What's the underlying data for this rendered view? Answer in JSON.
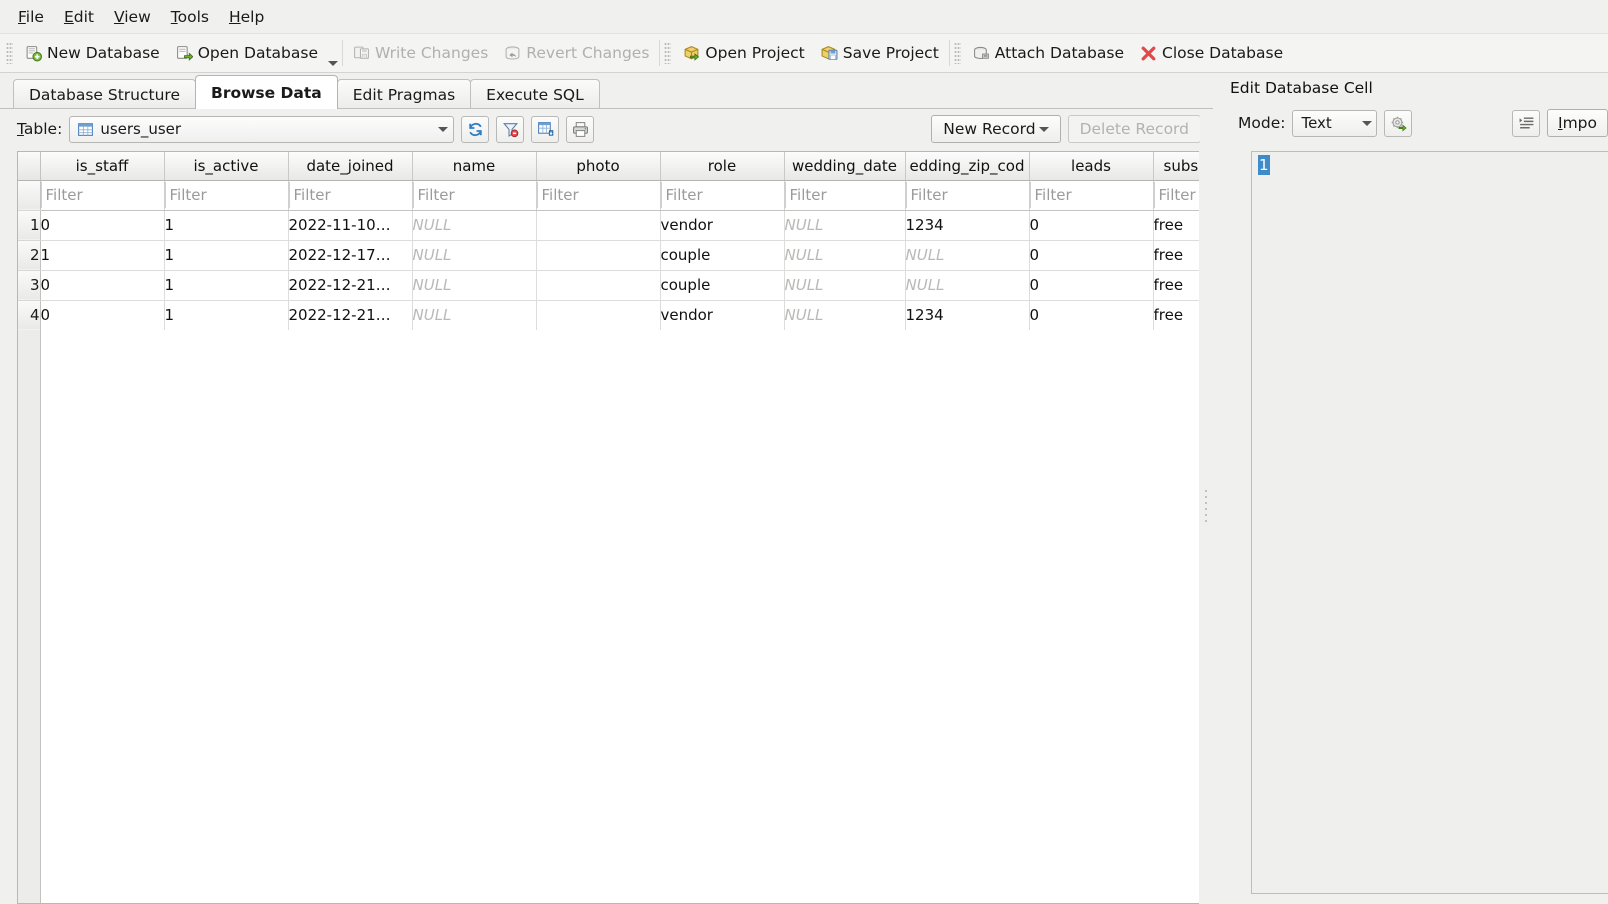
{
  "menu": {
    "items": [
      {
        "label": "File",
        "accel": "F",
        "rest": "ile"
      },
      {
        "label": "Edit",
        "accel": "E",
        "rest": "dit"
      },
      {
        "label": "View",
        "accel": "V",
        "rest": "iew"
      },
      {
        "label": "Tools",
        "accel": "T",
        "rest": "ools"
      },
      {
        "label": "Help",
        "accel": "H",
        "rest": "elp"
      }
    ]
  },
  "toolbar": {
    "new_database": "New Database",
    "open_database": "Open Database",
    "write_changes": "Write Changes",
    "revert_changes": "Revert Changes",
    "open_project": "Open Project",
    "save_project": "Save Project",
    "attach_database": "Attach Database",
    "close_database": "Close Database"
  },
  "tabs": [
    {
      "label": "Database Structure",
      "active": false
    },
    {
      "label": "Browse Data",
      "active": true
    },
    {
      "label": "Edit Pragmas",
      "active": false
    },
    {
      "label": "Execute SQL",
      "active": false
    }
  ],
  "browse": {
    "table_label": "Table:",
    "table_label_accel": "T",
    "table_label_rest": "able:",
    "selected_table": "users_user",
    "new_record": "New Record",
    "delete_record": "Delete Record",
    "filter_placeholder": "Filter"
  },
  "grid": {
    "columns": [
      "is_staff",
      "is_active",
      "date_joined",
      "name",
      "photo",
      "role",
      "wedding_date",
      "edding_zip_cod",
      "leads",
      "subsc"
    ],
    "row_numbers": [
      "1",
      "2",
      "3",
      "4"
    ],
    "rows": [
      [
        "0",
        "1",
        "2022-11-10…",
        "NULL",
        "",
        "vendor",
        "NULL",
        "1234",
        "0",
        "free"
      ],
      [
        "1",
        "1",
        "2022-12-17…",
        "NULL",
        "",
        "couple",
        "NULL",
        "NULL",
        "0",
        "free"
      ],
      [
        "0",
        "1",
        "2022-12-21…",
        "NULL",
        "",
        "couple",
        "NULL",
        "NULL",
        "0",
        "free"
      ],
      [
        "0",
        "1",
        "2022-12-21…",
        "NULL",
        "",
        "vendor",
        "NULL",
        "1234",
        "0",
        "free"
      ]
    ]
  },
  "edit_cell": {
    "title": "Edit Database Cell",
    "mode_label": "Mode:",
    "mode_value": "Text",
    "import_label": "Impo",
    "import_accel": "I",
    "import_rest": "mpo",
    "content": "1"
  },
  "colors": {
    "accent": "#3d8bca",
    "null_text": "#b9b9b7",
    "close_x": "#e04a4a",
    "window_bg": "#f0f0ef"
  }
}
